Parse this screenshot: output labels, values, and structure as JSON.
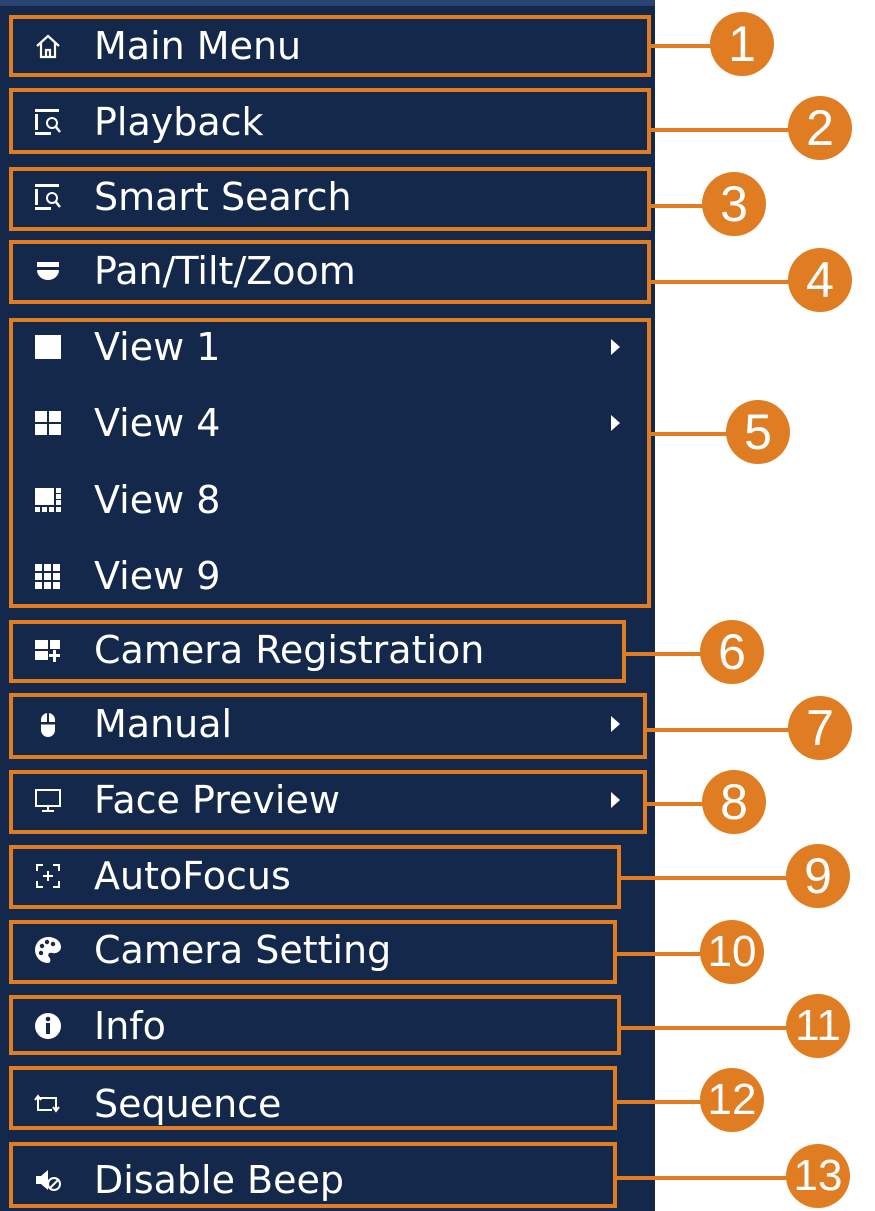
{
  "menu": {
    "items": [
      {
        "label": "Main Menu",
        "icon": "home-icon"
      },
      {
        "label": "Playback",
        "icon": "playback-icon"
      },
      {
        "label": "Smart Search",
        "icon": "smart-search-icon"
      },
      {
        "label": "Pan/Tilt/Zoom",
        "icon": "ptz-camera-icon"
      },
      {
        "label": "View 1",
        "icon": "view-1-icon",
        "submenu": true
      },
      {
        "label": "View 4",
        "icon": "view-4-icon",
        "submenu": true
      },
      {
        "label": "View 8",
        "icon": "view-8-icon"
      },
      {
        "label": "View 9",
        "icon": "view-9-icon"
      },
      {
        "label": "Camera Registration",
        "icon": "camera-registration-icon"
      },
      {
        "label": "Manual",
        "icon": "mouse-icon",
        "submenu": true
      },
      {
        "label": "Face Preview",
        "icon": "monitor-icon",
        "submenu": true
      },
      {
        "label": "AutoFocus",
        "icon": "autofocus-icon"
      },
      {
        "label": "Camera Setting",
        "icon": "palette-icon"
      },
      {
        "label": "Info",
        "icon": "info-icon"
      },
      {
        "label": "Sequence",
        "icon": "sequence-icon"
      },
      {
        "label": "Disable Beep",
        "icon": "speaker-mute-icon"
      }
    ]
  },
  "callouts": [
    "1",
    "2",
    "3",
    "4",
    "5",
    "6",
    "7",
    "8",
    "9",
    "10",
    "11",
    "12",
    "13"
  ],
  "colors": {
    "menu_background": "#14284b",
    "callout_orange": "#e07d22",
    "text": "#ffffff"
  }
}
